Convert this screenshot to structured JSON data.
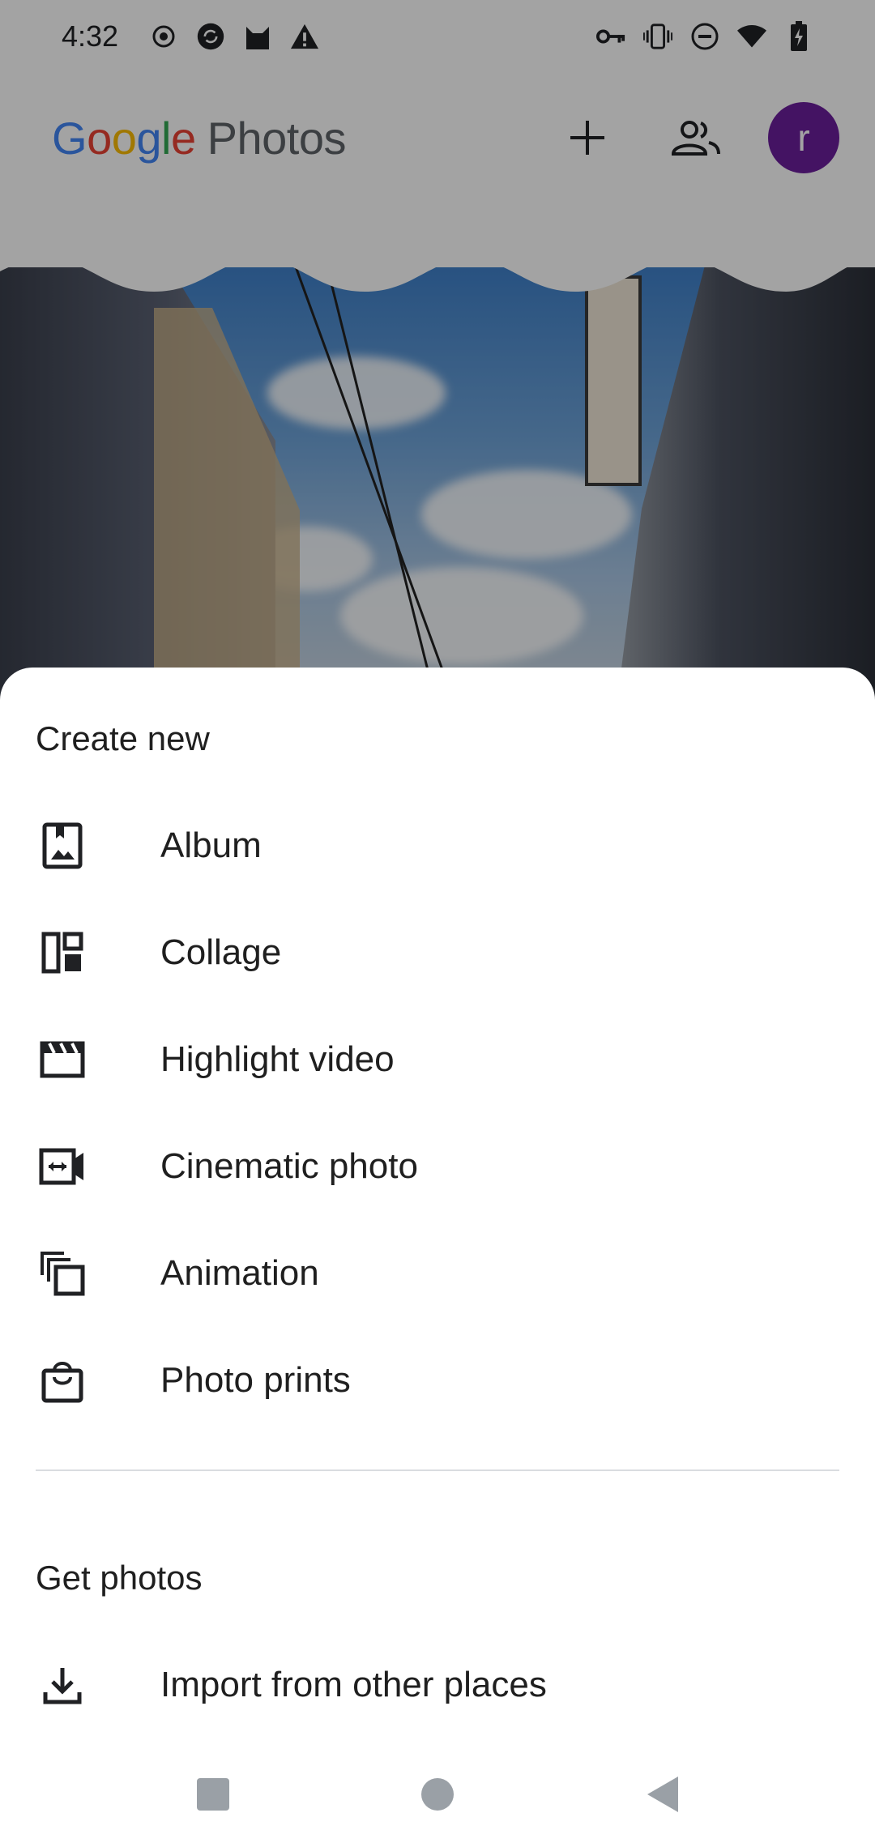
{
  "status_bar": {
    "time": "4:32",
    "left_icons": [
      "target-icon",
      "sync-icon",
      "cat-icon",
      "warning-icon"
    ],
    "right_icons": [
      "vpn-key-icon",
      "vibrate-icon",
      "do-not-disturb-icon",
      "wifi-icon",
      "battery-charging-icon"
    ]
  },
  "header": {
    "logo_google": [
      "G",
      "o",
      "o",
      "g",
      "l",
      "e"
    ],
    "logo_product": "Photos",
    "avatar_initial": "r"
  },
  "sheet": {
    "create_title": "Create new",
    "create_items": [
      {
        "label": "Album",
        "icon": "album-icon"
      },
      {
        "label": "Collage",
        "icon": "collage-icon"
      },
      {
        "label": "Highlight video",
        "icon": "highlight-video-icon"
      },
      {
        "label": "Cinematic photo",
        "icon": "cinematic-photo-icon"
      },
      {
        "label": "Animation",
        "icon": "animation-icon"
      },
      {
        "label": "Photo prints",
        "icon": "shopping-bag-icon"
      }
    ],
    "get_title": "Get photos",
    "get_items": [
      {
        "label": "Import from other places",
        "icon": "download-icon"
      }
    ]
  },
  "nav_bar": {
    "buttons": [
      "recents-button",
      "home-button",
      "back-button"
    ]
  },
  "colors": {
    "avatar_bg": "#6b1e9c",
    "scrim": "rgba(0,0,0,0.36)"
  }
}
